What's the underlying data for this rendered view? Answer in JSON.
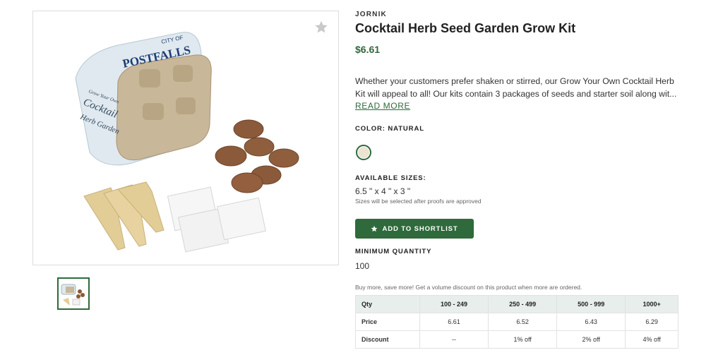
{
  "product": {
    "brand": "JORNIK",
    "title": "Cocktail Herb Seed Garden Grow Kit",
    "price": "$6.61",
    "description_line1": "Whether your customers prefer shaken or stirred, our Grow Your Own Cocktail Herb",
    "description_line2": "Kit will appeal to all! Our kits contain 3 packages of seeds and starter soil along wit...",
    "read_more": "READ MORE",
    "image_logo_small": "CITY OF",
    "image_logo_big": "POSTFALLS",
    "image_script_top": "Grow Your Own",
    "image_script_big": "Cocktail",
    "image_script_bottom": "Herb Garden"
  },
  "color": {
    "label": "COLOR: NATURAL",
    "swatch_color": "#ece4d3"
  },
  "sizes": {
    "label": "AVAILABLE SIZES:",
    "value": "6.5 \" x 4 \" x 3 \"",
    "note": "Sizes will be selected after proofs are approved"
  },
  "actions": {
    "shortlist_label": "ADD TO SHORTLIST"
  },
  "minimum": {
    "label": "MINIMUM QUANTITY",
    "value": "100"
  },
  "pricing": {
    "note": "Buy more, save more! Get a volume discount on this product when more are ordered.",
    "headers": [
      "Qty",
      "100 - 249",
      "250 - 499",
      "500 - 999",
      "1000+"
    ],
    "rows": [
      {
        "label": "Price",
        "values": [
          "6.61",
          "6.52",
          "6.43",
          "6.29"
        ]
      },
      {
        "label": "Discount",
        "values": [
          "--",
          "1% off",
          "2% off",
          "4% off"
        ]
      }
    ]
  },
  "colors": {
    "accent": "#2e6a3b",
    "table_header_bg": "#e8eeec"
  },
  "icons": {
    "favorite": "star-icon",
    "shortlist": "star-icon"
  }
}
